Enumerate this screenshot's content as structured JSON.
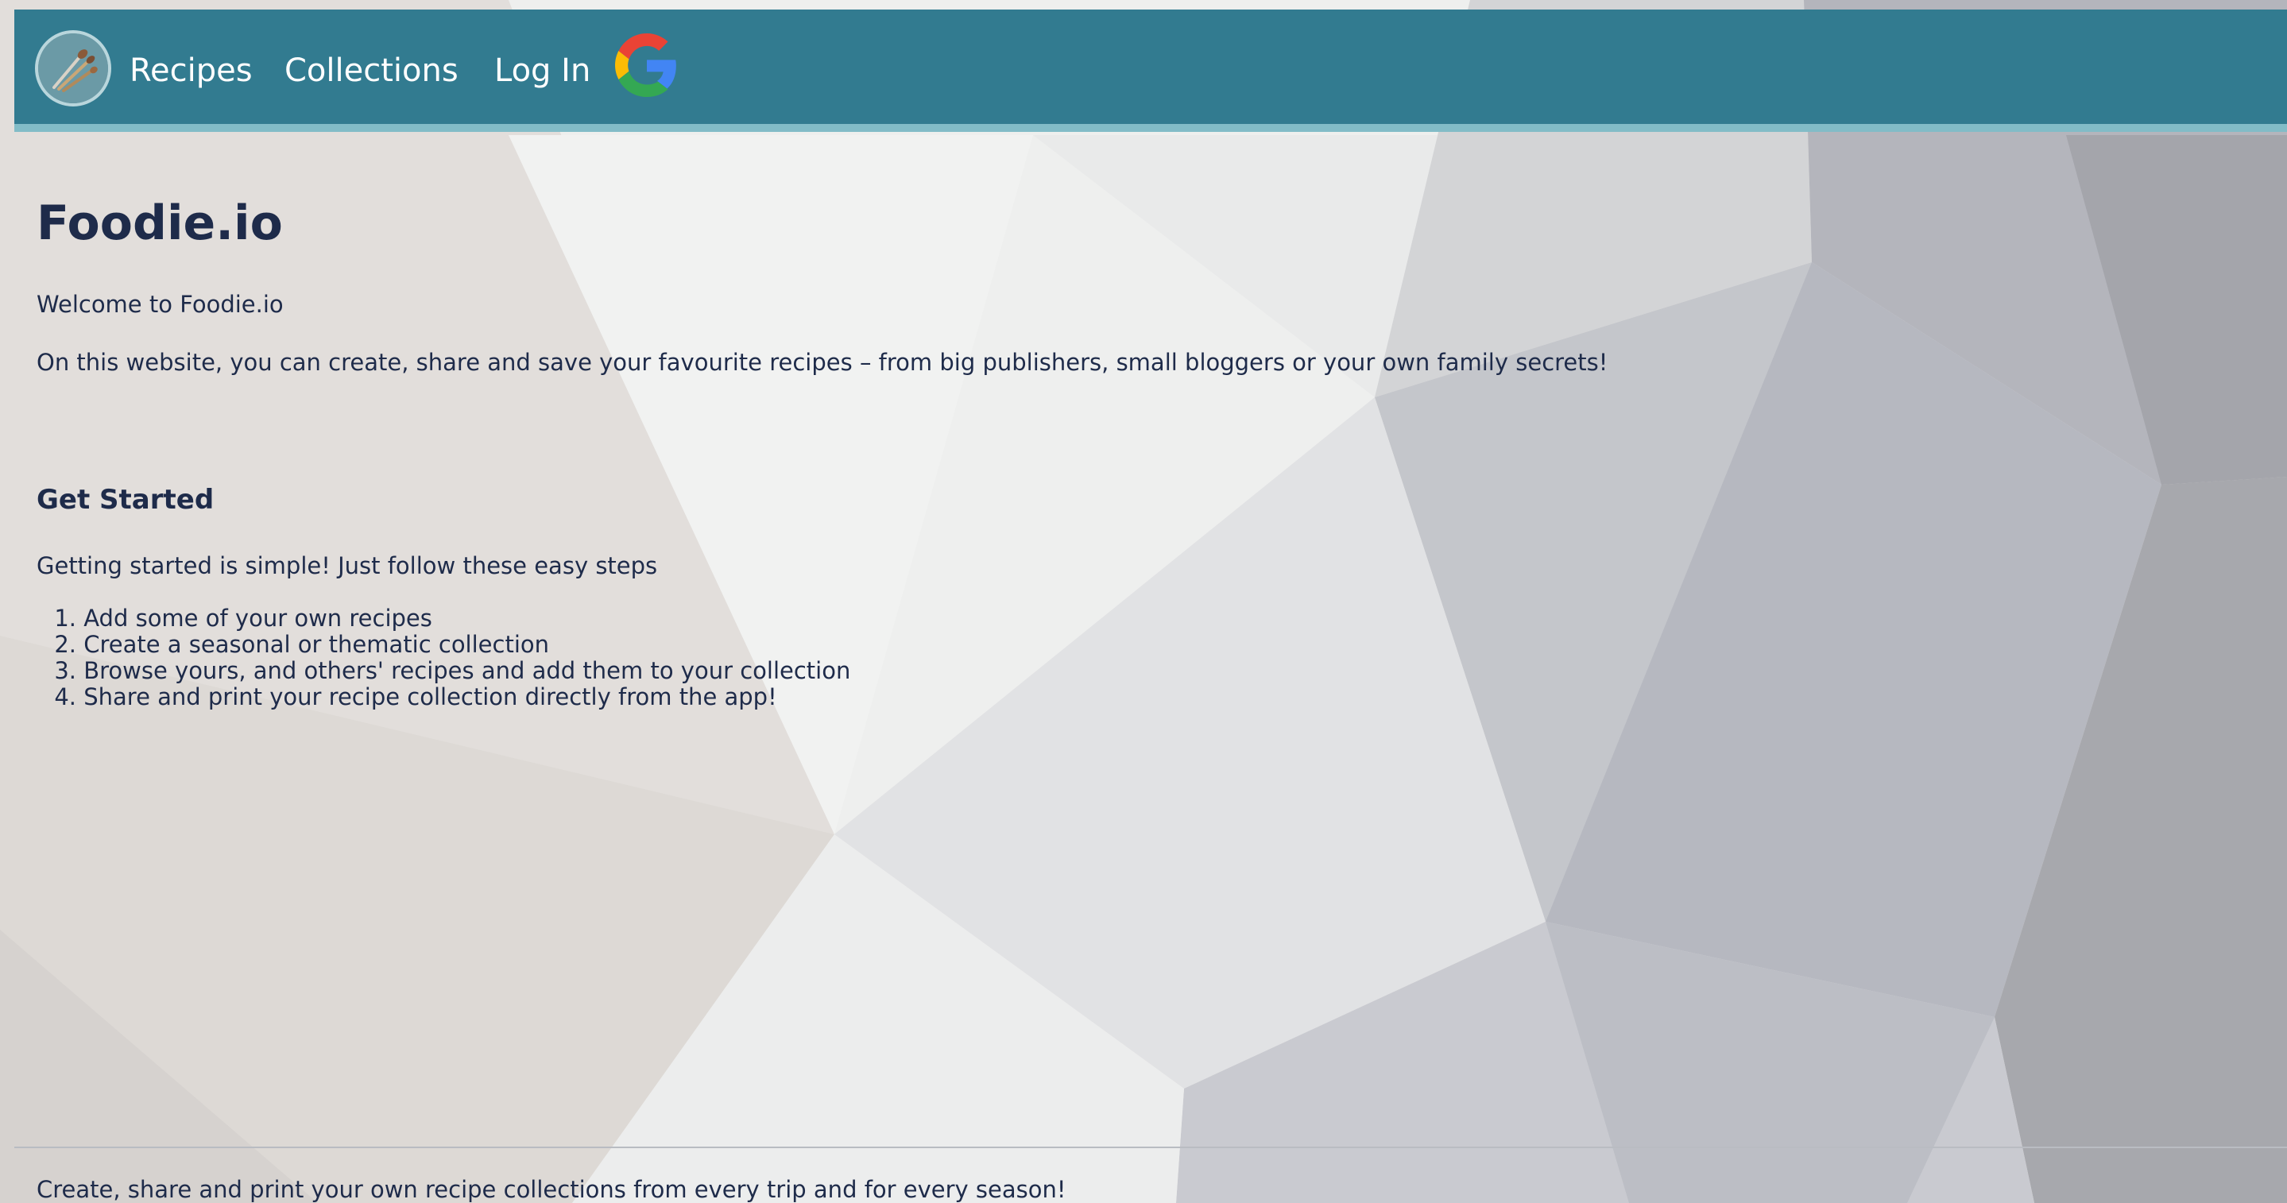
{
  "nav": {
    "logo_icon": "whisk-logo-icon",
    "links": [
      {
        "label": "Recipes"
      },
      {
        "label": "Collections"
      },
      {
        "label": "Log In"
      }
    ],
    "google_icon": "google-icon",
    "colors": {
      "bar": "#327b90",
      "accent_strip": "#82bcc7",
      "text": "#ffffff"
    }
  },
  "main": {
    "title": "Foodie.io",
    "welcome": "Welcome to Foodie.io",
    "intro": "On this website, you can create, share and save your favourite recipes – from big publishers, small bloggers or your own family secrets!",
    "get_started": {
      "heading": "Get Started",
      "text": "Getting started is simple! Just follow these easy steps",
      "steps": [
        {
          "num": "1.",
          "text": "Add some of your own recipes"
        },
        {
          "num": "2.",
          "text": "Create a seasonal or thematic collection"
        },
        {
          "num": "3.",
          "text": "Browse yours, and others' recipes and add them to your collection"
        },
        {
          "num": "4.",
          "text": "Share and print your recipe collection directly from the app!"
        }
      ]
    },
    "text_color": "#1e2b4a"
  },
  "footer": {
    "tagline": "Create, share and print your own recipe collections from every trip and for every season!"
  }
}
